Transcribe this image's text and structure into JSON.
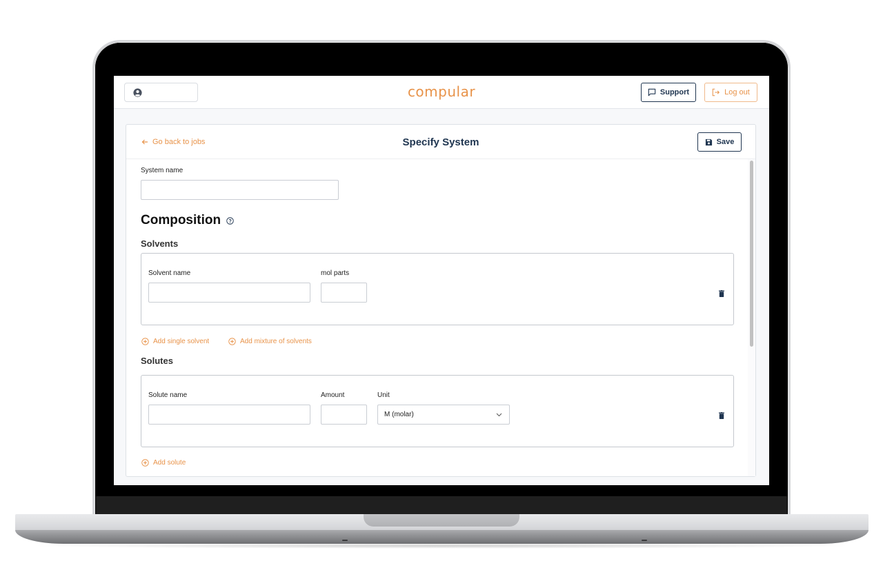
{
  "app": {
    "logo": "compular",
    "accent_color": "#e8934a",
    "primary_color": "#1f3550"
  },
  "topbar": {
    "user_icon": "user-circle-icon",
    "support_label": "Support",
    "support_icon": "chat-bubble-icon",
    "logout_label": "Log out",
    "logout_icon": "logout-arrow-icon"
  },
  "header": {
    "back_label": "Go back to jobs",
    "back_icon": "arrow-left-icon",
    "title": "Specify System",
    "save_label": "Save",
    "save_icon": "floppy-disk-icon"
  },
  "form": {
    "system_name_label": "System name",
    "system_name_value": "",
    "composition_heading": "Composition",
    "composition_help_icon": "question-circle-icon",
    "solvents": {
      "heading": "Solvents",
      "rows": [
        {
          "name_label": "Solvent name",
          "name_value": "",
          "parts_label": "mol parts",
          "parts_value": ""
        }
      ],
      "add_single_label": "Add single solvent",
      "add_mixture_label": "Add mixture of solvents"
    },
    "solutes": {
      "heading": "Solutes",
      "rows": [
        {
          "name_label": "Solute name",
          "name_value": "",
          "amount_label": "Amount",
          "amount_value": "",
          "unit_label": "Unit",
          "unit_value": "M (molar)"
        }
      ],
      "add_label": "Add solute"
    }
  }
}
